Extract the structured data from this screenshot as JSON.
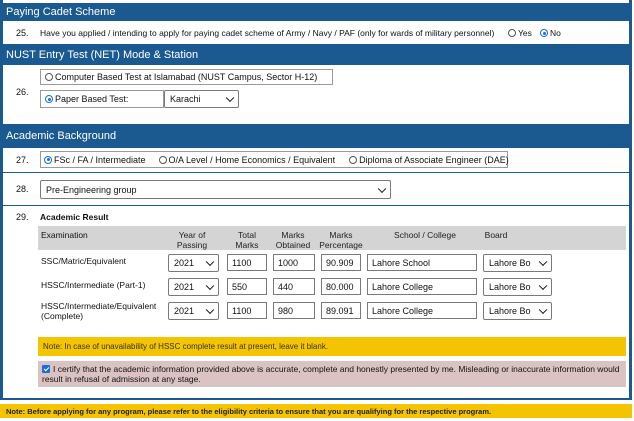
{
  "paying_cadet": {
    "header": "Paying Cadet Scheme",
    "num": "25.",
    "question": "Have you applied / intending to apply for paying cadet scheme of Army / Navy / PAF (only for wards of military personnel)",
    "options": [
      {
        "label": "Yes",
        "selected": false
      },
      {
        "label": "No",
        "selected": true
      }
    ]
  },
  "net": {
    "header": "NUST Entry Test (NET) Mode & Station",
    "num": "26.",
    "option_cbt": "Computer Based Test at Islamabad (NUST Campus, Sector H-12)",
    "option_pbt": "Paper Based Test:",
    "station_value": "Karachi"
  },
  "academic": {
    "header": "Academic Background",
    "q27_num": "27.",
    "q27_options": [
      {
        "label": "FSc / FA / Intermediate",
        "selected": true
      },
      {
        "label": "O/A Level / Home Economics / Equivalent",
        "selected": false
      },
      {
        "label": "Diploma of Associate Engineer (DAE)",
        "selected": false
      }
    ],
    "q28_num": "28.",
    "group_value": "Pre-Engineering group",
    "q29_num": "29.",
    "result_title": "Academic Result",
    "columns": {
      "examination": "Examination",
      "year": "Year of Passing",
      "total": "Total Marks",
      "obtained": "Marks Obtained",
      "percentage": "Marks Percentage",
      "school": "School / College",
      "board": "Board"
    },
    "rows": [
      {
        "exam": "SSC/Matric/Equivalent",
        "year": "2021",
        "total": "1100",
        "obtained": "1000",
        "percentage": "90.909",
        "school": "Lahore School",
        "board": "Lahore Bo"
      },
      {
        "exam": "HSSC/Intermediate (Part-1)",
        "year": "2021",
        "total": "550",
        "obtained": "440",
        "percentage": "80.000",
        "school": "Lahore College",
        "board": "Lahore Bo"
      },
      {
        "exam": "HSSC/Intermediate/Equivalent (Complete)",
        "year": "2021",
        "total": "1100",
        "obtained": "980",
        "percentage": "89.091",
        "school": "Lahore College",
        "board": "Lahore Bo"
      }
    ],
    "hssc_note": "Note: In case of unavailability of HSSC complete result at present, leave it blank.",
    "certify_checked": true,
    "certify_text": "I certify that the academic information provided above is accurate, complete and honestly presented by me. Misleading or inaccurate information would result in refusal of admission at any stage."
  },
  "footer_note": "Note: Before applying for any program, please refer to the eligibility criteria to ensure that you are qualifying for the respective program."
}
